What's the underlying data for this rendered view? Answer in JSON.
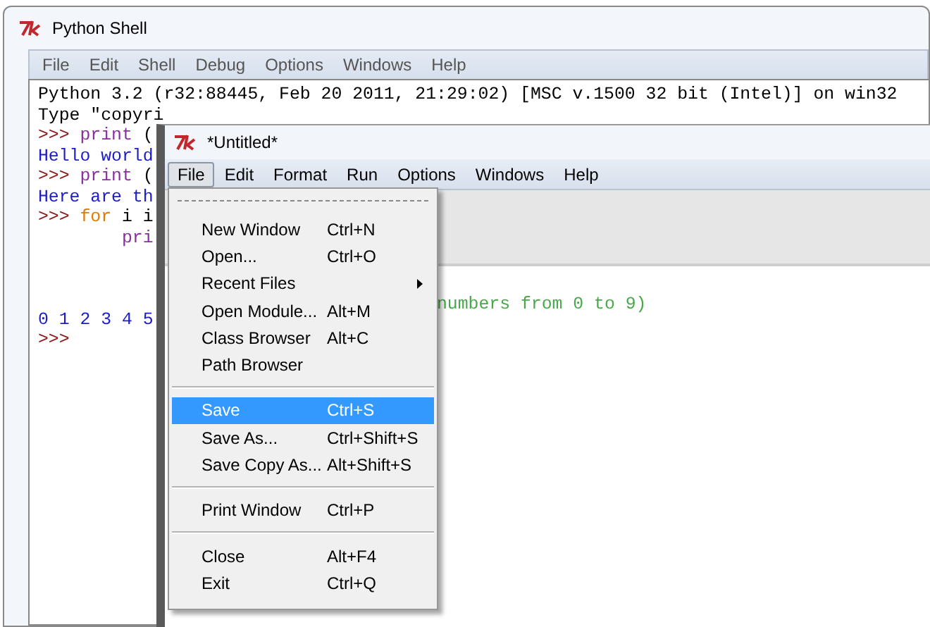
{
  "shell": {
    "title": "Python Shell",
    "menu": [
      {
        "label": "File"
      },
      {
        "label": "Edit"
      },
      {
        "label": "Shell"
      },
      {
        "label": "Debug"
      },
      {
        "label": "Options"
      },
      {
        "label": "Windows"
      },
      {
        "label": "Help"
      }
    ],
    "lines": [
      [
        {
          "kind": "plain",
          "text": "Python 3.2 (r32:88445, Feb 20 2011, 21:29:02) [MSC v.1500 32 bit (Intel)] on win32"
        }
      ],
      [
        {
          "kind": "plain",
          "text": "Type \"copyri"
        }
      ],
      [
        {
          "kind": "prompt",
          "text": ">>> "
        },
        {
          "kind": "builtin",
          "text": "print"
        },
        {
          "kind": "plain",
          "text": " ("
        }
      ],
      [
        {
          "kind": "output",
          "text": "Hello world"
        }
      ],
      [
        {
          "kind": "prompt",
          "text": ">>> "
        },
        {
          "kind": "builtin",
          "text": "print"
        },
        {
          "kind": "plain",
          "text": " ("
        }
      ],
      [
        {
          "kind": "output",
          "text": "Here are th"
        }
      ],
      [
        {
          "kind": "prompt",
          "text": ">>> "
        },
        {
          "kind": "keyword",
          "text": "for"
        },
        {
          "kind": "plain",
          "text": " i i"
        }
      ],
      [
        {
          "kind": "builtin",
          "text": "        pri"
        }
      ]
    ],
    "result_lines": [
      [
        {
          "kind": "output",
          "text": "0 1 2 3 4 5"
        }
      ],
      [
        {
          "kind": "prompt",
          "text": ">>>"
        }
      ]
    ]
  },
  "editor": {
    "title": "*Untitled*",
    "menu": [
      {
        "label": "File",
        "selected": true
      },
      {
        "label": "Edit",
        "selected": false
      },
      {
        "label": "Format",
        "selected": false
      },
      {
        "label": "Run",
        "selected": false
      },
      {
        "label": "Options",
        "selected": false
      },
      {
        "label": "Windows",
        "selected": false
      },
      {
        "label": "Help",
        "selected": false
      }
    ],
    "ghost_text": "numbers from 0 to 9)"
  },
  "file_menu": [
    {
      "kind": "item",
      "label": "New Window",
      "shortcut": "Ctrl+N",
      "selected": false
    },
    {
      "kind": "item",
      "label": "Open...",
      "shortcut": "Ctrl+O",
      "selected": false
    },
    {
      "kind": "submenu",
      "label": "Recent Files",
      "selected": false
    },
    {
      "kind": "item",
      "label": "Open Module...",
      "shortcut": "Alt+M",
      "selected": false
    },
    {
      "kind": "item",
      "label": "Class Browser",
      "shortcut": "Alt+C",
      "selected": false
    },
    {
      "kind": "item",
      "label": "Path Browser",
      "selected": false
    },
    {
      "kind": "separator"
    },
    {
      "kind": "item",
      "label": "Save",
      "shortcut": "Ctrl+S",
      "selected": true
    },
    {
      "kind": "item",
      "label": "Save As...",
      "shortcut": "Ctrl+Shift+S",
      "selected": false
    },
    {
      "kind": "item",
      "label": "Save Copy As...",
      "shortcut": "Alt+Shift+S",
      "selected": false
    },
    {
      "kind": "separator"
    },
    {
      "kind": "item",
      "label": "Print Window",
      "shortcut": "Ctrl+P",
      "selected": false
    },
    {
      "kind": "separator"
    },
    {
      "kind": "item",
      "label": "Close",
      "shortcut": "Alt+F4",
      "selected": false
    },
    {
      "kind": "item",
      "label": "Exit",
      "shortcut": "Ctrl+Q",
      "selected": false
    }
  ]
}
